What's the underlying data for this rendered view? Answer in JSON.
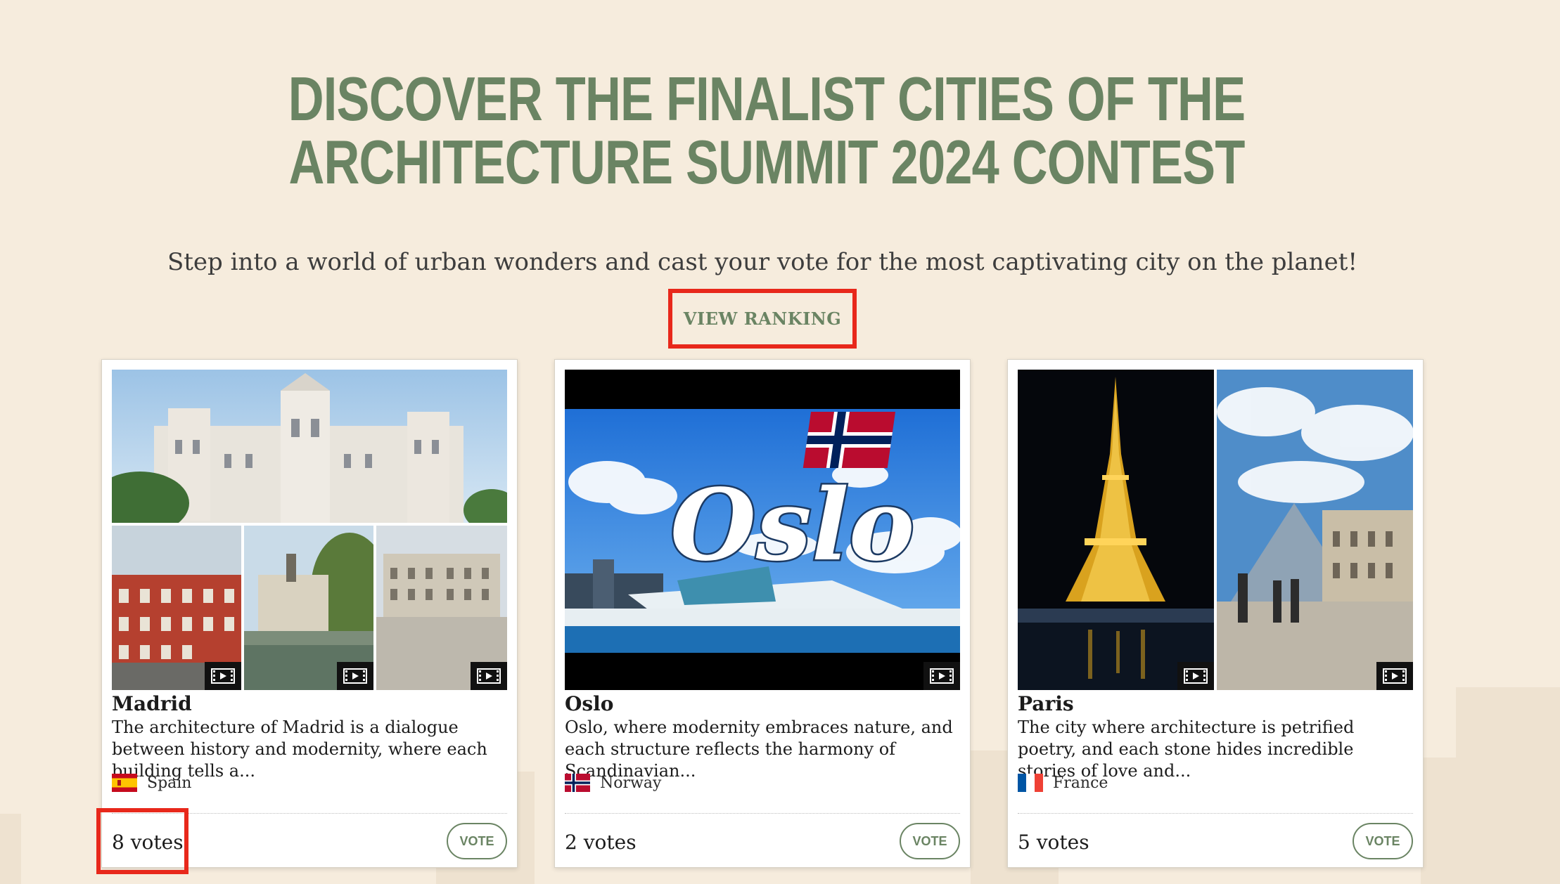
{
  "page": {
    "title": "DISCOVER THE FINALIST CITIES OF THE ARCHITECTURE SUMMIT 2024 CONTEST",
    "subtitle": "Step into a world of urban wonders and cast your vote for the most captivating city on the planet!",
    "ranking_button": "VIEW RANKING"
  },
  "cities": [
    {
      "name": "Madrid",
      "description": "The architecture of Madrid is a dialogue between history and modernity, where each building tells a...",
      "country": "Spain",
      "flag": "spain-flag",
      "votes": "8 votes",
      "vote_label": "VOTE"
    },
    {
      "name": "Oslo",
      "description": "Oslo, where modernity embraces nature, and each structure reflects the harmony of Scandinavian...",
      "country": "Norway",
      "flag": "norway-flag",
      "media_text": "Oslo",
      "votes": "2 votes",
      "vote_label": "VOTE"
    },
    {
      "name": "Paris",
      "description": "The city where architecture is petrified poetry, and each stone hides incredible stories of love and...",
      "country": "France",
      "flag": "france-flag",
      "votes": "5 votes",
      "vote_label": "VOTE"
    }
  ],
  "colors": {
    "background": "#f6ecdd",
    "accent_green": "#6a8463",
    "highlight_red": "#e8281b"
  }
}
